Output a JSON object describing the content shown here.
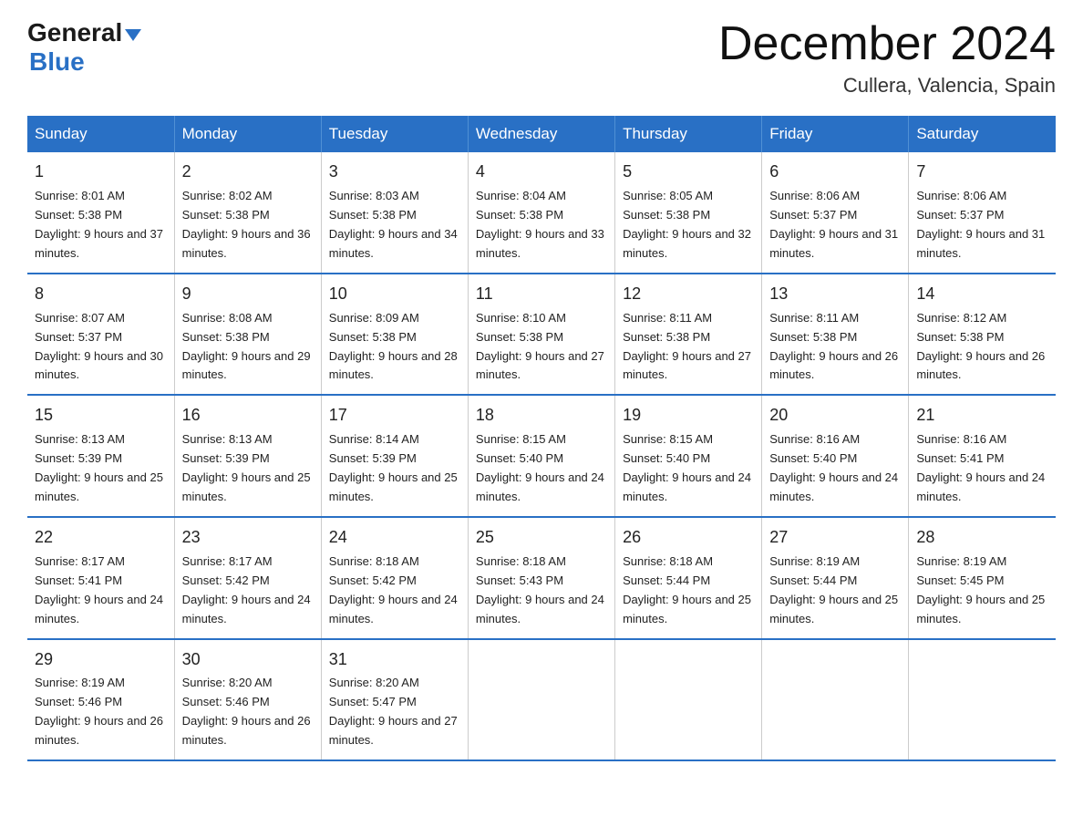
{
  "logo": {
    "general": "General",
    "triangle": "▶",
    "blue": "Blue"
  },
  "title": "December 2024",
  "location": "Cullera, Valencia, Spain",
  "days_of_week": [
    "Sunday",
    "Monday",
    "Tuesday",
    "Wednesday",
    "Thursday",
    "Friday",
    "Saturday"
  ],
  "weeks": [
    [
      {
        "day": "1",
        "sunrise": "8:01 AM",
        "sunset": "5:38 PM",
        "daylight": "9 hours and 37 minutes."
      },
      {
        "day": "2",
        "sunrise": "8:02 AM",
        "sunset": "5:38 PM",
        "daylight": "9 hours and 36 minutes."
      },
      {
        "day": "3",
        "sunrise": "8:03 AM",
        "sunset": "5:38 PM",
        "daylight": "9 hours and 34 minutes."
      },
      {
        "day": "4",
        "sunrise": "8:04 AM",
        "sunset": "5:38 PM",
        "daylight": "9 hours and 33 minutes."
      },
      {
        "day": "5",
        "sunrise": "8:05 AM",
        "sunset": "5:38 PM",
        "daylight": "9 hours and 32 minutes."
      },
      {
        "day": "6",
        "sunrise": "8:06 AM",
        "sunset": "5:37 PM",
        "daylight": "9 hours and 31 minutes."
      },
      {
        "day": "7",
        "sunrise": "8:06 AM",
        "sunset": "5:37 PM",
        "daylight": "9 hours and 31 minutes."
      }
    ],
    [
      {
        "day": "8",
        "sunrise": "8:07 AM",
        "sunset": "5:37 PM",
        "daylight": "9 hours and 30 minutes."
      },
      {
        "day": "9",
        "sunrise": "8:08 AM",
        "sunset": "5:38 PM",
        "daylight": "9 hours and 29 minutes."
      },
      {
        "day": "10",
        "sunrise": "8:09 AM",
        "sunset": "5:38 PM",
        "daylight": "9 hours and 28 minutes."
      },
      {
        "day": "11",
        "sunrise": "8:10 AM",
        "sunset": "5:38 PM",
        "daylight": "9 hours and 27 minutes."
      },
      {
        "day": "12",
        "sunrise": "8:11 AM",
        "sunset": "5:38 PM",
        "daylight": "9 hours and 27 minutes."
      },
      {
        "day": "13",
        "sunrise": "8:11 AM",
        "sunset": "5:38 PM",
        "daylight": "9 hours and 26 minutes."
      },
      {
        "day": "14",
        "sunrise": "8:12 AM",
        "sunset": "5:38 PM",
        "daylight": "9 hours and 26 minutes."
      }
    ],
    [
      {
        "day": "15",
        "sunrise": "8:13 AM",
        "sunset": "5:39 PM",
        "daylight": "9 hours and 25 minutes."
      },
      {
        "day": "16",
        "sunrise": "8:13 AM",
        "sunset": "5:39 PM",
        "daylight": "9 hours and 25 minutes."
      },
      {
        "day": "17",
        "sunrise": "8:14 AM",
        "sunset": "5:39 PM",
        "daylight": "9 hours and 25 minutes."
      },
      {
        "day": "18",
        "sunrise": "8:15 AM",
        "sunset": "5:40 PM",
        "daylight": "9 hours and 24 minutes."
      },
      {
        "day": "19",
        "sunrise": "8:15 AM",
        "sunset": "5:40 PM",
        "daylight": "9 hours and 24 minutes."
      },
      {
        "day": "20",
        "sunrise": "8:16 AM",
        "sunset": "5:40 PM",
        "daylight": "9 hours and 24 minutes."
      },
      {
        "day": "21",
        "sunrise": "8:16 AM",
        "sunset": "5:41 PM",
        "daylight": "9 hours and 24 minutes."
      }
    ],
    [
      {
        "day": "22",
        "sunrise": "8:17 AM",
        "sunset": "5:41 PM",
        "daylight": "9 hours and 24 minutes."
      },
      {
        "day": "23",
        "sunrise": "8:17 AM",
        "sunset": "5:42 PM",
        "daylight": "9 hours and 24 minutes."
      },
      {
        "day": "24",
        "sunrise": "8:18 AM",
        "sunset": "5:42 PM",
        "daylight": "9 hours and 24 minutes."
      },
      {
        "day": "25",
        "sunrise": "8:18 AM",
        "sunset": "5:43 PM",
        "daylight": "9 hours and 24 minutes."
      },
      {
        "day": "26",
        "sunrise": "8:18 AM",
        "sunset": "5:44 PM",
        "daylight": "9 hours and 25 minutes."
      },
      {
        "day": "27",
        "sunrise": "8:19 AM",
        "sunset": "5:44 PM",
        "daylight": "9 hours and 25 minutes."
      },
      {
        "day": "28",
        "sunrise": "8:19 AM",
        "sunset": "5:45 PM",
        "daylight": "9 hours and 25 minutes."
      }
    ],
    [
      {
        "day": "29",
        "sunrise": "8:19 AM",
        "sunset": "5:46 PM",
        "daylight": "9 hours and 26 minutes."
      },
      {
        "day": "30",
        "sunrise": "8:20 AM",
        "sunset": "5:46 PM",
        "daylight": "9 hours and 26 minutes."
      },
      {
        "day": "31",
        "sunrise": "8:20 AM",
        "sunset": "5:47 PM",
        "daylight": "9 hours and 27 minutes."
      },
      null,
      null,
      null,
      null
    ]
  ]
}
